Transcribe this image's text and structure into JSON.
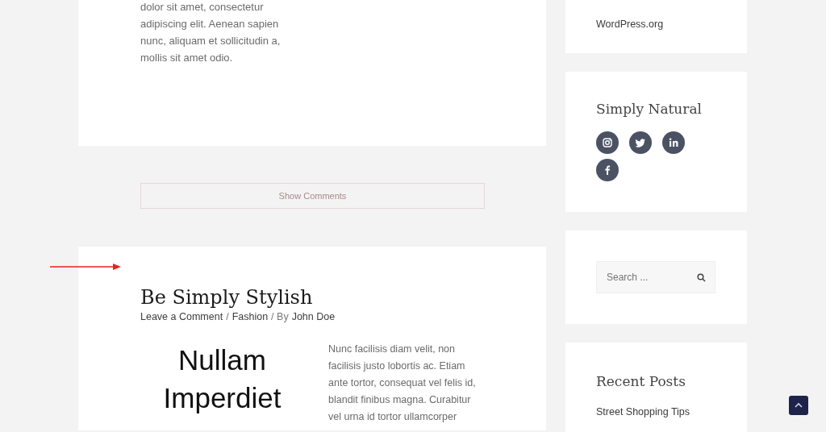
{
  "previous_post": {
    "excerpt": "dolor sit amet, consectetur adipiscing elit. Aenean sapien nunc, aliquam et sollicitudin a, mollis sit amet odio."
  },
  "comments_button": {
    "label": "Show Comments"
  },
  "post": {
    "title": "Be Simply Stylish",
    "meta": [
      {
        "kind": "link",
        "text": "Leave a Comment"
      },
      {
        "kind": "text",
        "text": "/"
      },
      {
        "kind": "link",
        "text": "Fashion"
      },
      {
        "kind": "text",
        "text": "/ By"
      },
      {
        "kind": "link",
        "text": "John Doe"
      }
    ],
    "featured_text": "Nullam Imperdiet",
    "excerpt": "Nunc facilisis diam velit, non facilisis justo lobortis ac. Etiam ante tortor, consequat vel felis id, blandit finibus magna. Curabitur vel urna id tortor ullamcorper"
  },
  "sidebar": [
    {
      "kind": "links",
      "items": [
        "WordPress.org"
      ]
    },
    {
      "kind": "social",
      "title": "Simply Natural"
    },
    {
      "kind": "search",
      "placeholder": "Search ..."
    },
    {
      "kind": "links",
      "title": "Recent Posts",
      "items": [
        "Street Shopping Tips"
      ]
    }
  ]
}
